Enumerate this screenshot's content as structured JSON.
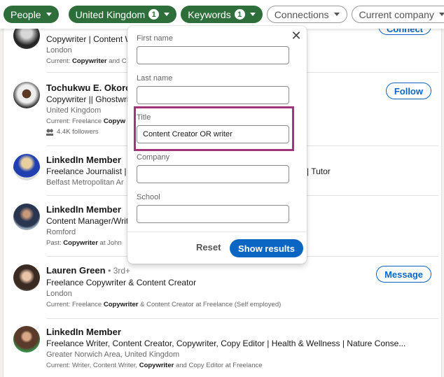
{
  "filters": [
    {
      "label": "People",
      "active": true,
      "count": null
    },
    {
      "label": "United Kingdom",
      "active": true,
      "count": "1"
    },
    {
      "label": "Keywords",
      "active": true,
      "count": "1"
    },
    {
      "label": "Connections",
      "active": false,
      "count": null
    },
    {
      "label": "Current company",
      "active": false,
      "count": null
    }
  ],
  "results": [
    {
      "name": "",
      "degree": "",
      "headline": "Copywriter | Content W",
      "location": "London",
      "snippet_prefix": "Current: ",
      "snippet_bold": "Copywriter",
      "snippet_suffix": " and C",
      "action": "Connect",
      "followers": ""
    },
    {
      "name": "Tochukwu E. Okoro",
      "degree": "",
      "headline": "Copywriter || Ghostwri",
      "location": "United Kingdom",
      "snippet_prefix": "Current: Freelance ",
      "snippet_bold": "Copyw",
      "snippet_suffix": "",
      "action": "Follow",
      "followers": "4.4K followers"
    },
    {
      "name": "LinkedIn Member",
      "degree": "",
      "headline": "Freelance Journalist | E",
      "headline_tail": "er | Tutor",
      "location": "Belfast Metropolitan Ar",
      "snippet_prefix": "",
      "snippet_bold": "",
      "snippet_suffix": "",
      "action": "",
      "followers": ""
    },
    {
      "name": "LinkedIn Member",
      "degree": "",
      "headline": "Content Manager/Write",
      "location": "Romford",
      "snippet_prefix": "Past: ",
      "snippet_bold": "Copywriter",
      "snippet_suffix": " at John",
      "action": "",
      "followers": ""
    },
    {
      "name": "Lauren Green",
      "degree": "• 3rd+",
      "headline": "Freelance Copywriter & Content Creator",
      "location": "London",
      "snippet_prefix": "Current: Freelance ",
      "snippet_bold": "Copywriter",
      "snippet_suffix": " & Content Creator at Freelance (Self employed)",
      "action": "Message",
      "followers": ""
    },
    {
      "name": "LinkedIn Member",
      "degree": "",
      "headline": "Freelance Writer, Content Creator, Copywriter, Copy Editor | Health & Wellness | Nature Conse...",
      "location": "Greater Norwich Area, United Kingdom",
      "snippet_prefix": "Current: Writer, Content Writer, ",
      "snippet_bold": "Copywriter",
      "snippet_suffix": " and Copy Editor at Freelance",
      "action": "",
      "followers": ""
    }
  ],
  "popup": {
    "first_name_label": "First name",
    "first_name_value": "",
    "last_name_label": "Last name",
    "last_name_value": "",
    "title_label": "Title",
    "title_value": "Content Creator OR writer",
    "company_label": "Company",
    "company_value": "",
    "school_label": "School",
    "school_value": "",
    "close_glyph": "✕",
    "reset_label": "Reset",
    "show_results_label": "Show results"
  },
  "colors": {
    "filter_active": "#2e6e3b",
    "primary_blue": "#0a66c2",
    "highlight": "#a1347a"
  }
}
